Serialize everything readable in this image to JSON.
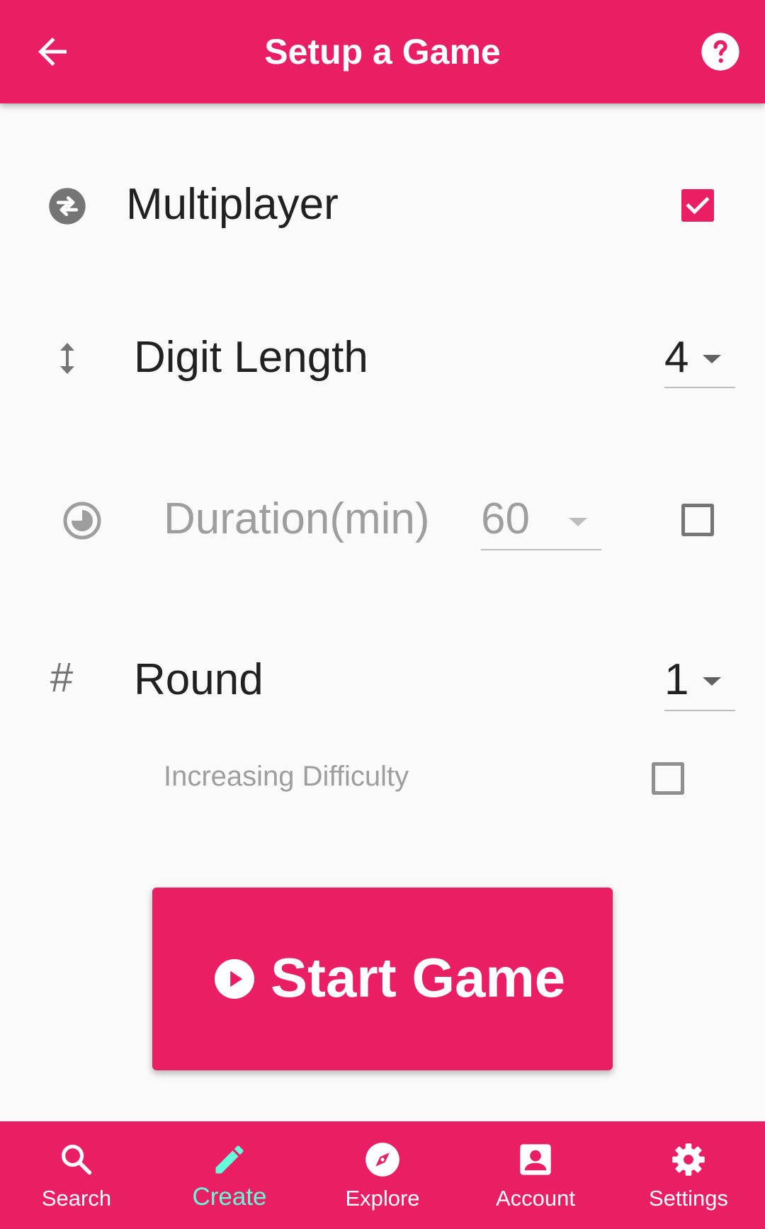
{
  "colors": {
    "primary": "#E91E63",
    "accent": "#64FFDA",
    "on_primary": "#FFFFFF",
    "background": "#FAFAFA"
  },
  "appbar": {
    "title": "Setup a Game",
    "back_icon": "arrow-back-icon",
    "help_icon": "help-circle-icon"
  },
  "settings": {
    "multiplayer": {
      "label": "Multiplayer",
      "icon": "swap-circle-icon",
      "checked": true
    },
    "digit_length": {
      "label": "Digit Length",
      "icon": "vertical-arrows-icon",
      "selected": "4"
    },
    "duration": {
      "label": "Duration(min)",
      "icon": "timer-icon",
      "selected": "60",
      "enabled": false,
      "checked": false
    },
    "round": {
      "label": "Round",
      "icon": "hash-icon",
      "icon_glyph": "#",
      "selected": "1"
    },
    "increasing_difficulty": {
      "label": "Increasing Difficulty",
      "checked": false
    }
  },
  "start_button": {
    "label": "Start Game",
    "icon": "play-circle-icon"
  },
  "bottom_nav": {
    "items": [
      {
        "label": "Search",
        "icon": "search-icon",
        "active": false
      },
      {
        "label": "Create",
        "icon": "pencil-icon",
        "active": true
      },
      {
        "label": "Explore",
        "icon": "compass-icon",
        "active": false
      },
      {
        "label": "Account",
        "icon": "account-box-icon",
        "active": false
      },
      {
        "label": "Settings",
        "icon": "gear-icon",
        "active": false
      }
    ]
  }
}
